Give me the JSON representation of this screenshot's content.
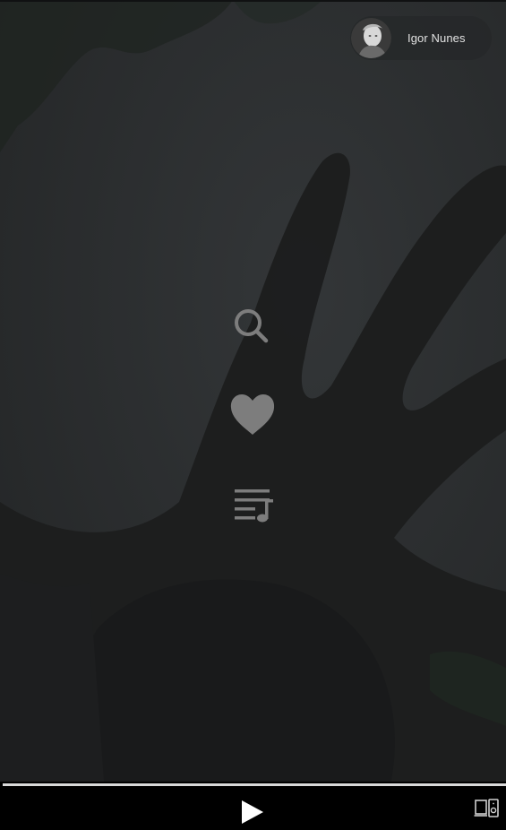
{
  "user": {
    "name": "Igor Nunes"
  },
  "menu": {
    "icons": [
      "search-icon",
      "heart-icon",
      "queue-music-icon"
    ]
  },
  "player": {
    "progress": 1.0,
    "play_icon": "play-icon",
    "device_icon": "devices-icon"
  },
  "colors": {
    "background": "#262829",
    "icon": "#7d7d7d",
    "player_bar": "#000000",
    "progress": "#d9d9d9"
  }
}
